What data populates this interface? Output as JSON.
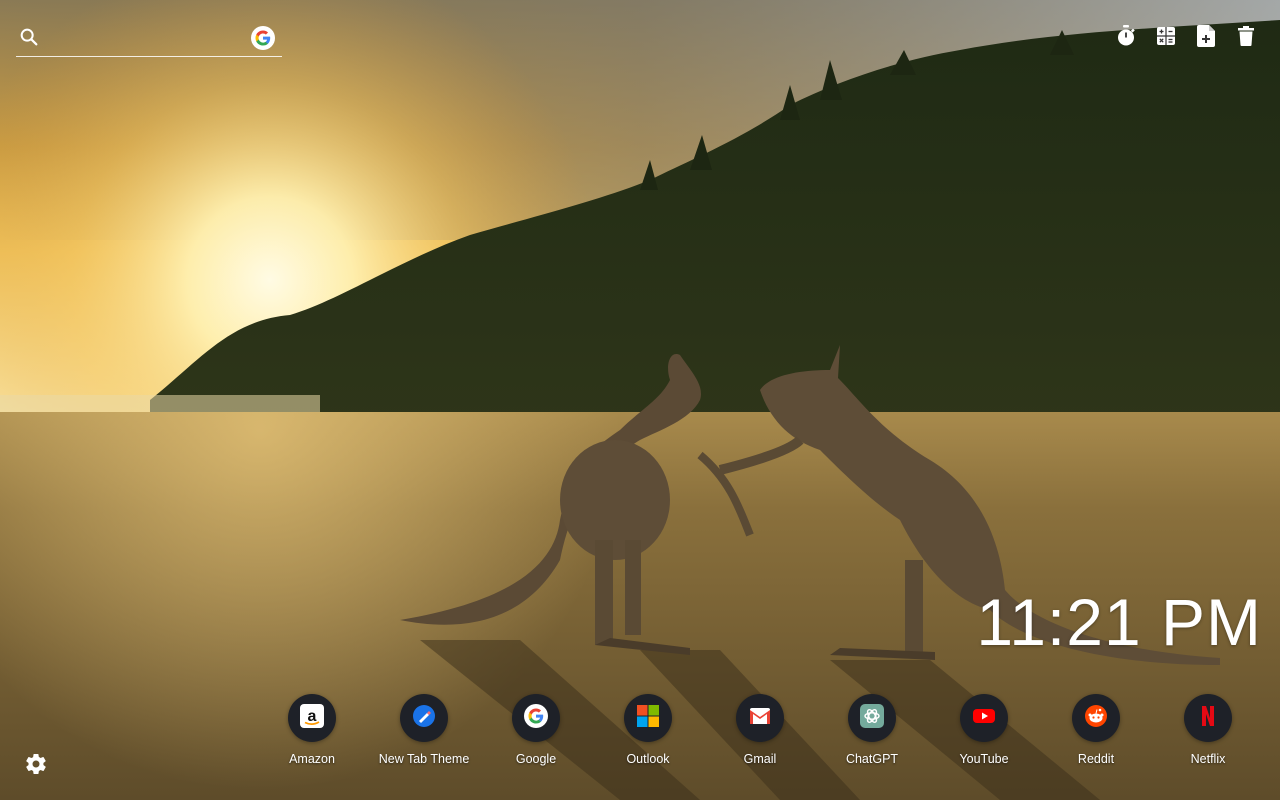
{
  "search": {
    "value": "",
    "placeholder": "",
    "engine_icon": "google-g-icon"
  },
  "toolbar": {
    "items": [
      {
        "icon": "stopwatch-icon"
      },
      {
        "icon": "calculator-icon"
      },
      {
        "icon": "add-note-icon"
      },
      {
        "icon": "trash-icon"
      }
    ]
  },
  "clock": {
    "time": "11:21 PM"
  },
  "shortcuts": [
    {
      "label": "Amazon",
      "icon": "amazon-icon",
      "color": "#ffffff"
    },
    {
      "label": "New Tab Theme",
      "icon": "new-tab-theme-icon",
      "color": "#1a73e8"
    },
    {
      "label": "Google",
      "icon": "google-icon",
      "color": "#ffffff"
    },
    {
      "label": "Outlook",
      "icon": "outlook-icon",
      "color": "#f25022"
    },
    {
      "label": "Gmail",
      "icon": "gmail-icon",
      "color": "#ea4335"
    },
    {
      "label": "ChatGPT",
      "icon": "chatgpt-icon",
      "color": "#74aa9c"
    },
    {
      "label": "YouTube",
      "icon": "youtube-icon",
      "color": "#ff0000"
    },
    {
      "label": "Reddit",
      "icon": "reddit-icon",
      "color": "#ff4500"
    },
    {
      "label": "Netflix",
      "icon": "netflix-icon",
      "color": "#e50914"
    }
  ],
  "settings": {
    "icon": "gear-icon"
  },
  "wallpaper": {
    "subject": "kangaroos-on-beach-at-sunrise"
  }
}
